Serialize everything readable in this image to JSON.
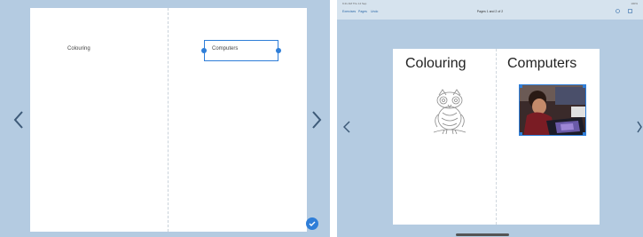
{
  "left": {
    "labels": [
      "Colouring",
      "Computers"
    ]
  },
  "right": {
    "topbar": {
      "status_left": "9:41 AM  Thu 14 Sep",
      "status_right": "100%",
      "items": [
        "Exercises",
        "Pages",
        "Undo"
      ],
      "page_indicator": "Pages 1 and 2 of 2"
    },
    "labels": [
      "Colouring",
      "Computers"
    ]
  },
  "colors": {
    "background": "#b4cbe1",
    "accent": "#2f7ed8",
    "page": "#ffffff"
  },
  "icons": [
    "chevron-left-icon",
    "chevron-right-icon",
    "checkmark-icon",
    "owl-drawing",
    "computer-photo"
  ]
}
